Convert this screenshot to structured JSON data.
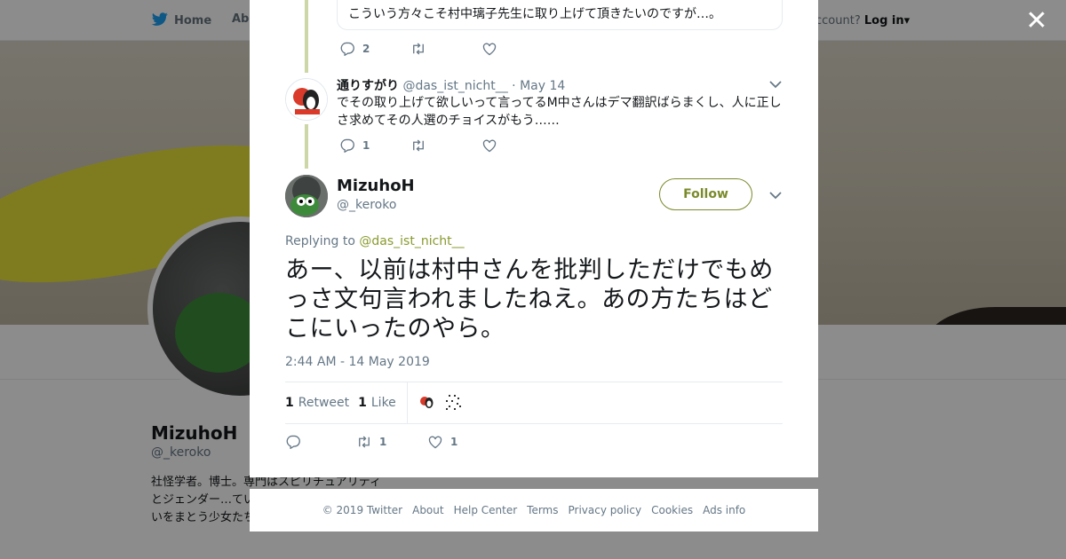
{
  "background": {
    "nav_home": "Home",
    "nav_about": "Abo",
    "login_prompt": "ccount?",
    "login_link": "Log in",
    "profile_name": "MizuhoH",
    "profile_handle": "@_keroko",
    "profile_bio": "社怪学者。博士。専門はスピリチュアリティとジェンダー…ています。 転載禁…よ。「占いをまとう少女たち」(青弓社)"
  },
  "reply_thread_top": {
    "quoted_text": "こういう方々こそ村中璃子先生に取り上げて頂きたいのですが…。",
    "reply_count": "2"
  },
  "reply": {
    "name": "通りすがり",
    "handle": "@das_ist_nicht__",
    "date": "· May 14",
    "text": "でその取り上げて欲しいって言ってるM中さんはデマ翻訳ばらまくし、人に正しさ求めてその人選のチョイスがもう……",
    "reply_count": "1"
  },
  "main_tweet": {
    "name": "MizuhoH",
    "handle": "@_keroko",
    "follow_label": "Follow",
    "replying_prefix": "Replying to",
    "replying_to": "@das_ist_nicht__",
    "text": "あー、以前は村中さんを批判しただけでもめっさ文句言われましたねえ。あの方たちはどこにいったのやら。",
    "timestamp": "2:44 AM - 14 May 2019",
    "retweet_count": "1",
    "retweet_label": "Retweet",
    "like_count": "1",
    "like_label": "Like",
    "action_retweet_count": "1",
    "action_like_count": "1"
  },
  "footer": {
    "copyright": "© 2019 Twitter",
    "about": "About",
    "help": "Help Center",
    "terms": "Terms",
    "privacy": "Privacy policy",
    "cookies": "Cookies",
    "ads": "Ads info"
  },
  "icons": [
    "twitter-bird-icon",
    "close-icon",
    "reply-icon",
    "retweet-icon",
    "like-icon",
    "chevron-down-icon"
  ],
  "colors": {
    "accent": "#7a8a2a",
    "link": "#8a9a2e",
    "thread": "#ccd6a6"
  }
}
